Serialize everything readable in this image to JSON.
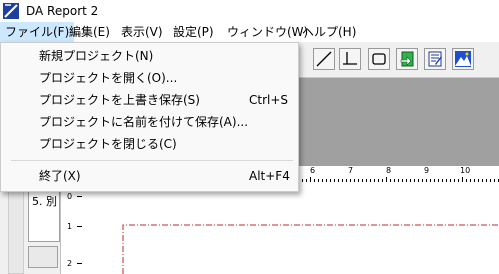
{
  "window": {
    "title": "DA Report 2"
  },
  "menubar": {
    "items": [
      {
        "label": "ファイル(F)",
        "active": true
      },
      {
        "label": "編集(E)"
      },
      {
        "label": "表示(V)"
      },
      {
        "label": "設定(P)"
      },
      {
        "label": "ウィンドウ(W)"
      },
      {
        "label": "ヘルプ(H)"
      }
    ]
  },
  "file_menu": {
    "items": [
      {
        "label": "新規プロジェクト(N)",
        "shortcut": ""
      },
      {
        "label": "プロジェクトを開く(O)...",
        "shortcut": ""
      },
      {
        "label": "プロジェクトを上書き保存(S)",
        "shortcut": "Ctrl+S"
      },
      {
        "label": "プロジェクトに名前を付けて保存(A)...",
        "shortcut": ""
      },
      {
        "label": "プロジェクトを閉じる(C)",
        "shortcut": ""
      },
      {
        "label": "終了(X)",
        "shortcut": "Alt+F4"
      }
    ]
  },
  "toolbar": {
    "icons": [
      "line-icon",
      "baseline-icon",
      "rectangle-icon",
      "green-doc-icon",
      "edit-doc-icon",
      "mountain-image-icon"
    ]
  },
  "ruler": {
    "h_labels": [
      "6",
      "7",
      "8",
      "9",
      "10"
    ],
    "v_labels": [
      "0",
      "1",
      "2"
    ]
  },
  "left_panel": {
    "list_item": "5. 別"
  },
  "colors": {
    "menu_highlight": "#cce8ff",
    "gray_band": "#a0a0a0",
    "page_border": "#c0292a"
  }
}
